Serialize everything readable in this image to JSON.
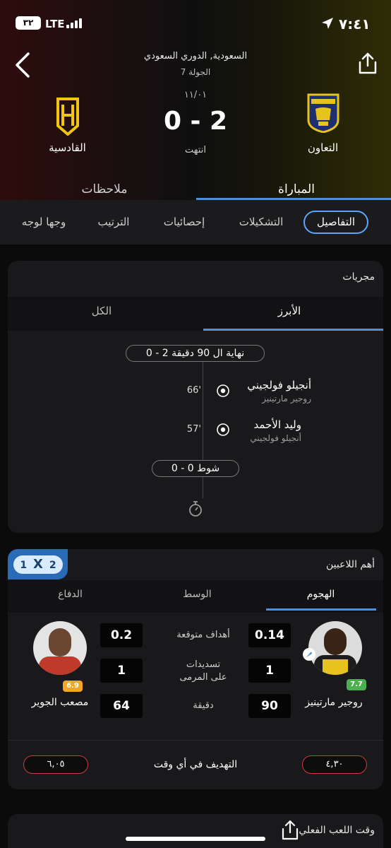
{
  "status_bar": {
    "time": "٧:٤١",
    "network": "LTE",
    "battery": "٣٢"
  },
  "header": {
    "league": "السعودية, الدوري السعودي",
    "round": "الجولة 7",
    "date": "١١/٠١",
    "score": "0 - 2",
    "status": "انتهت",
    "home_team": "التعاون",
    "away_team": "القادسية"
  },
  "main_tabs": [
    {
      "label": "المباراة",
      "active": true
    },
    {
      "label": "ملاحظات",
      "active": false
    }
  ],
  "sub_tabs": [
    {
      "label": "التفاصيل",
      "active": true
    },
    {
      "label": "التشكيلات",
      "active": false
    },
    {
      "label": "إحصائيات",
      "active": false
    },
    {
      "label": "الترتيب",
      "active": false
    },
    {
      "label": "وجها لوجه",
      "active": false
    }
  ],
  "events": {
    "title": "مجريات",
    "tabs": [
      {
        "label": "الأبرز",
        "active": true
      },
      {
        "label": "الكل",
        "active": false
      }
    ],
    "fulltime": "نهاية ال 90 دقيقة 2 - 0",
    "items": [
      {
        "minute": "66'",
        "scorer": "أنجيلو فولجيني",
        "assist": "روجير مارتينيز"
      },
      {
        "minute": "57'",
        "scorer": "وليد الأحمد",
        "assist": "أنجيلو فولجيني"
      }
    ],
    "halftime": "شوط 0 - 0"
  },
  "top_players": {
    "title": "أهم اللاعبين",
    "odds_badge": [
      "1",
      "X",
      "2"
    ],
    "tabs": [
      {
        "label": "الهجوم",
        "active": true
      },
      {
        "label": "الوسط",
        "active": false
      },
      {
        "label": "الدفاع",
        "active": false
      }
    ],
    "home_player": {
      "name": "روجير مارتينيز",
      "rating": "7.7"
    },
    "away_player": {
      "name": "مصعب الجوير",
      "rating": "6.9"
    },
    "stats": [
      {
        "label": "أهداف متوقعة",
        "home": "0.14",
        "away": "0.2"
      },
      {
        "label": "تسديدات على المرمى",
        "home": "1",
        "away": "1"
      },
      {
        "label": "دقيقة",
        "home": "90",
        "away": "64"
      }
    ],
    "anytime": {
      "label": "التهديف في أي وقت",
      "home": "٤,٣٠",
      "away": "٦,٠٥"
    }
  },
  "next_card": {
    "title": "وقت اللعب الفعلي"
  },
  "colors": {
    "accent": "#4a90e2",
    "rating_green": "#4caf50",
    "rating_orange": "#f5a623",
    "odds_red": "#d23a3a"
  }
}
